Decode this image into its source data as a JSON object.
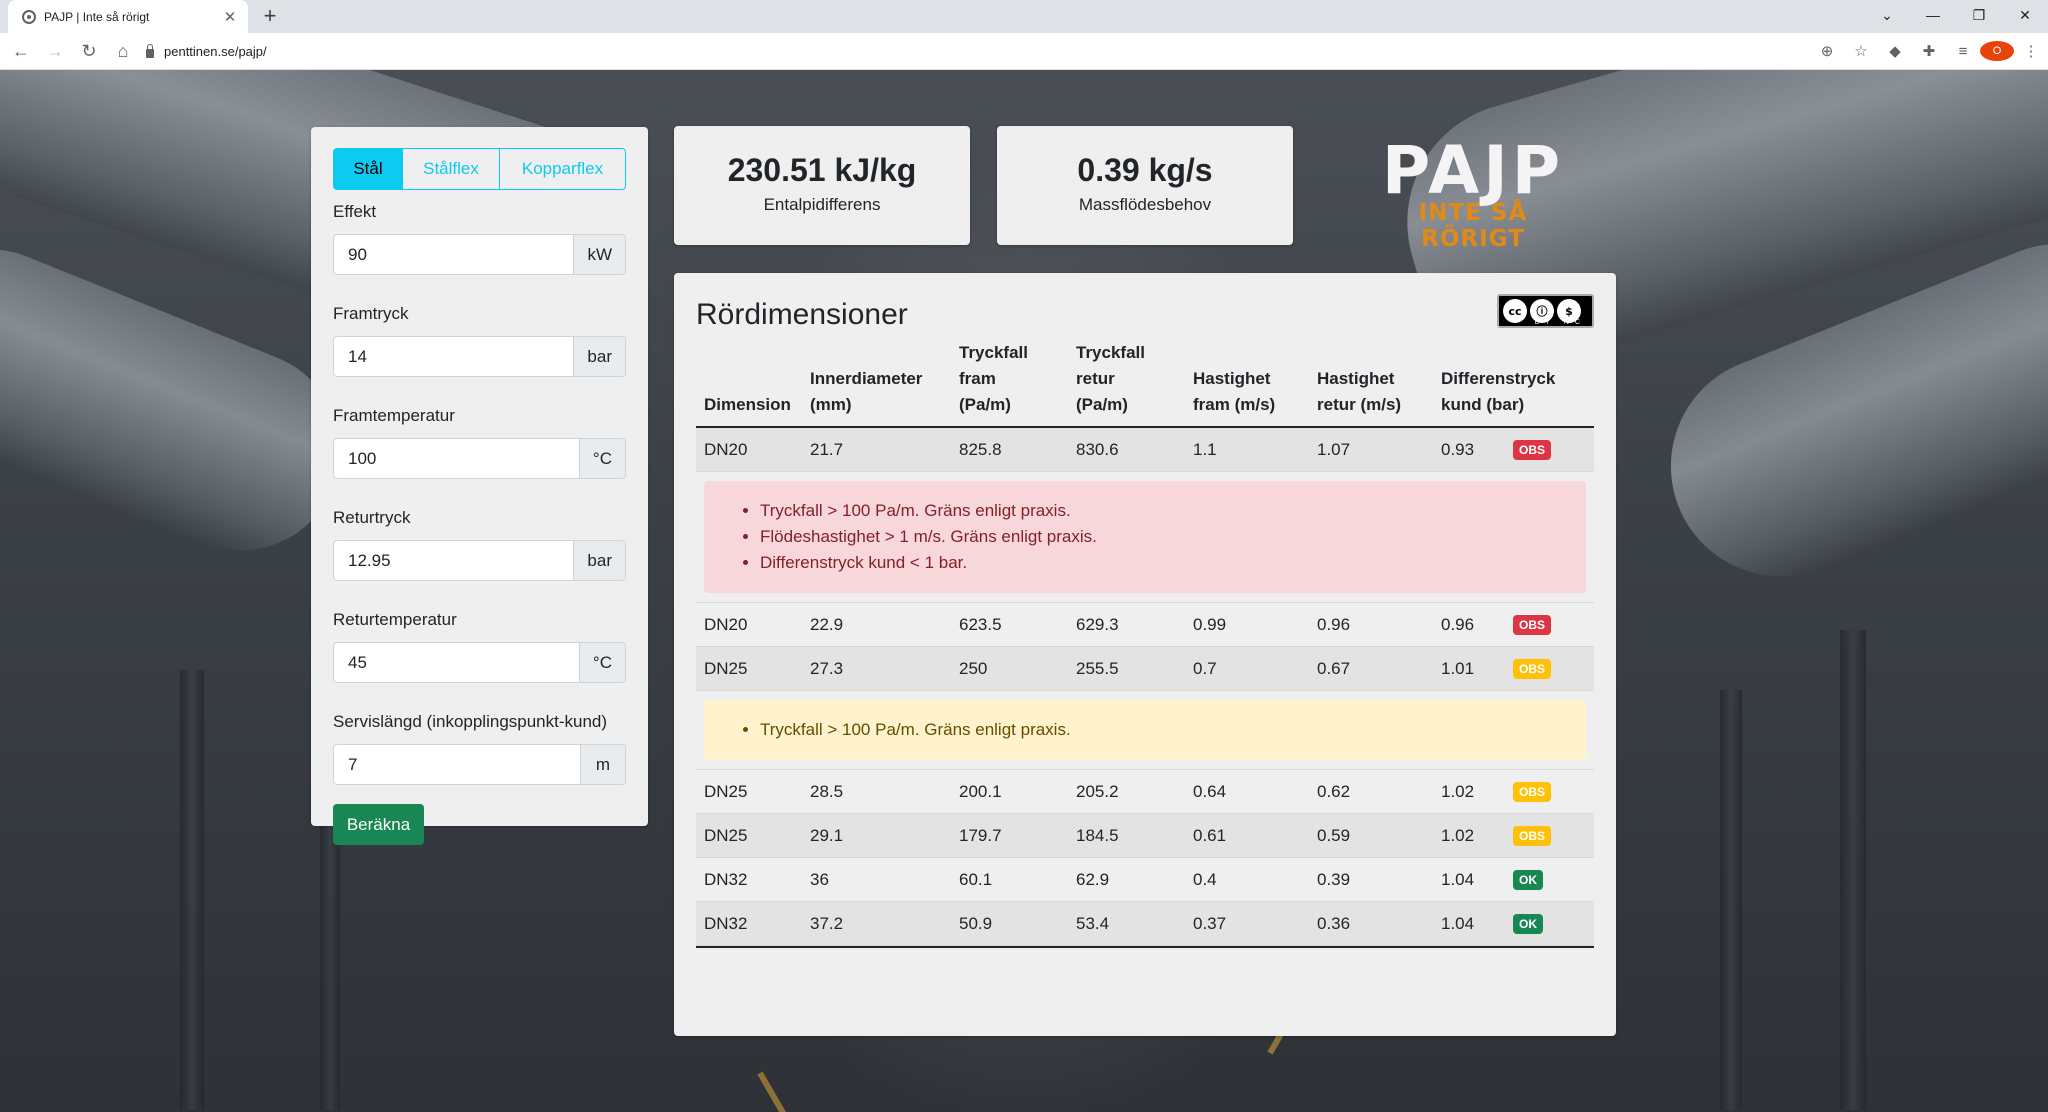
{
  "browser": {
    "tab_title": "PAJP | Inte så rörigt",
    "url": "penttinen.se/pajp/",
    "profile_initial": "O"
  },
  "form": {
    "material_tabs": [
      "Stål",
      "Stålflex",
      "Kopparflex"
    ],
    "active_material": "Stål",
    "fields": [
      {
        "label": "Effekt",
        "value": "90",
        "unit": "kW"
      },
      {
        "label": "Framtryck",
        "value": "14",
        "unit": "bar"
      },
      {
        "label": "Framtemperatur",
        "value": "100",
        "unit": "°C"
      },
      {
        "label": "Returtryck",
        "value": "12.95",
        "unit": "bar"
      },
      {
        "label": "Returtemperatur",
        "value": "45",
        "unit": "°C"
      },
      {
        "label": "Servislängd (inkopplingspunkt-kund)",
        "value": "7",
        "unit": "m"
      }
    ],
    "submit_label": "Beräkna"
  },
  "stats": {
    "enthalpy": {
      "value": "230.51 kJ/kg",
      "label": "Entalpidifferens"
    },
    "massflow": {
      "value": "0.39 kg/s",
      "label": "Massflödesbehov"
    }
  },
  "logo": {
    "title": "PAJP",
    "tagline": "INTE SÅ RÖRIGT"
  },
  "table": {
    "title": "Rördimensioner",
    "license": {
      "cc": "cc",
      "by": "BY",
      "nc": "NC"
    },
    "headers": [
      [
        "Dimension"
      ],
      [
        "Innerdiameter",
        "(mm)"
      ],
      [
        "Tryckfall",
        "fram",
        "(Pa/m)"
      ],
      [
        "Tryckfall",
        "retur",
        "(Pa/m)"
      ],
      [
        "Hastighet",
        "fram (m/s)"
      ],
      [
        "Hastighet",
        "retur (m/s)"
      ],
      [
        "Differenstryck",
        "kund (bar)"
      ]
    ],
    "rows": [
      {
        "dim": "DN20",
        "id": "21.7",
        "dp_f": "825.8",
        "dp_r": "830.6",
        "v_f": "1.1",
        "v_r": "1.07",
        "dp_k": "0.93",
        "badge": "OBS",
        "level": "red",
        "notes": [
          "Tryckfall > 100 Pa/m. Gräns enligt praxis.",
          "Flödeshastighet > 1 m/s. Gräns enligt praxis.",
          "Differenstryck kund < 1 bar."
        ]
      },
      {
        "dim": "DN20",
        "id": "22.9",
        "dp_f": "623.5",
        "dp_r": "629.3",
        "v_f": "0.99",
        "v_r": "0.96",
        "dp_k": "0.96",
        "badge": "OBS",
        "level": "red",
        "notes": []
      },
      {
        "dim": "DN25",
        "id": "27.3",
        "dp_f": "250",
        "dp_r": "255.5",
        "v_f": "0.7",
        "v_r": "0.67",
        "dp_k": "1.01",
        "badge": "OBS",
        "level": "yellow",
        "notes": [
          "Tryckfall > 100 Pa/m. Gräns enligt praxis."
        ]
      },
      {
        "dim": "DN25",
        "id": "28.5",
        "dp_f": "200.1",
        "dp_r": "205.2",
        "v_f": "0.64",
        "v_r": "0.62",
        "dp_k": "1.02",
        "badge": "OBS",
        "level": "yellow",
        "notes": []
      },
      {
        "dim": "DN25",
        "id": "29.1",
        "dp_f": "179.7",
        "dp_r": "184.5",
        "v_f": "0.61",
        "v_r": "0.59",
        "dp_k": "1.02",
        "badge": "OBS",
        "level": "yellow",
        "notes": []
      },
      {
        "dim": "DN32",
        "id": "36",
        "dp_f": "60.1",
        "dp_r": "62.9",
        "v_f": "0.4",
        "v_r": "0.39",
        "dp_k": "1.04",
        "badge": "OK",
        "level": "green",
        "notes": []
      },
      {
        "dim": "DN32",
        "id": "37.2",
        "dp_f": "50.9",
        "dp_r": "53.4",
        "v_f": "0.37",
        "v_r": "0.36",
        "dp_k": "1.04",
        "badge": "OK",
        "level": "green",
        "notes": []
      }
    ]
  },
  "colors": {
    "accent_info": "#0dcaf0",
    "success": "#198754",
    "danger": "#dc3545",
    "warning": "#ffc107",
    "logo_orange": "#e28a16"
  }
}
